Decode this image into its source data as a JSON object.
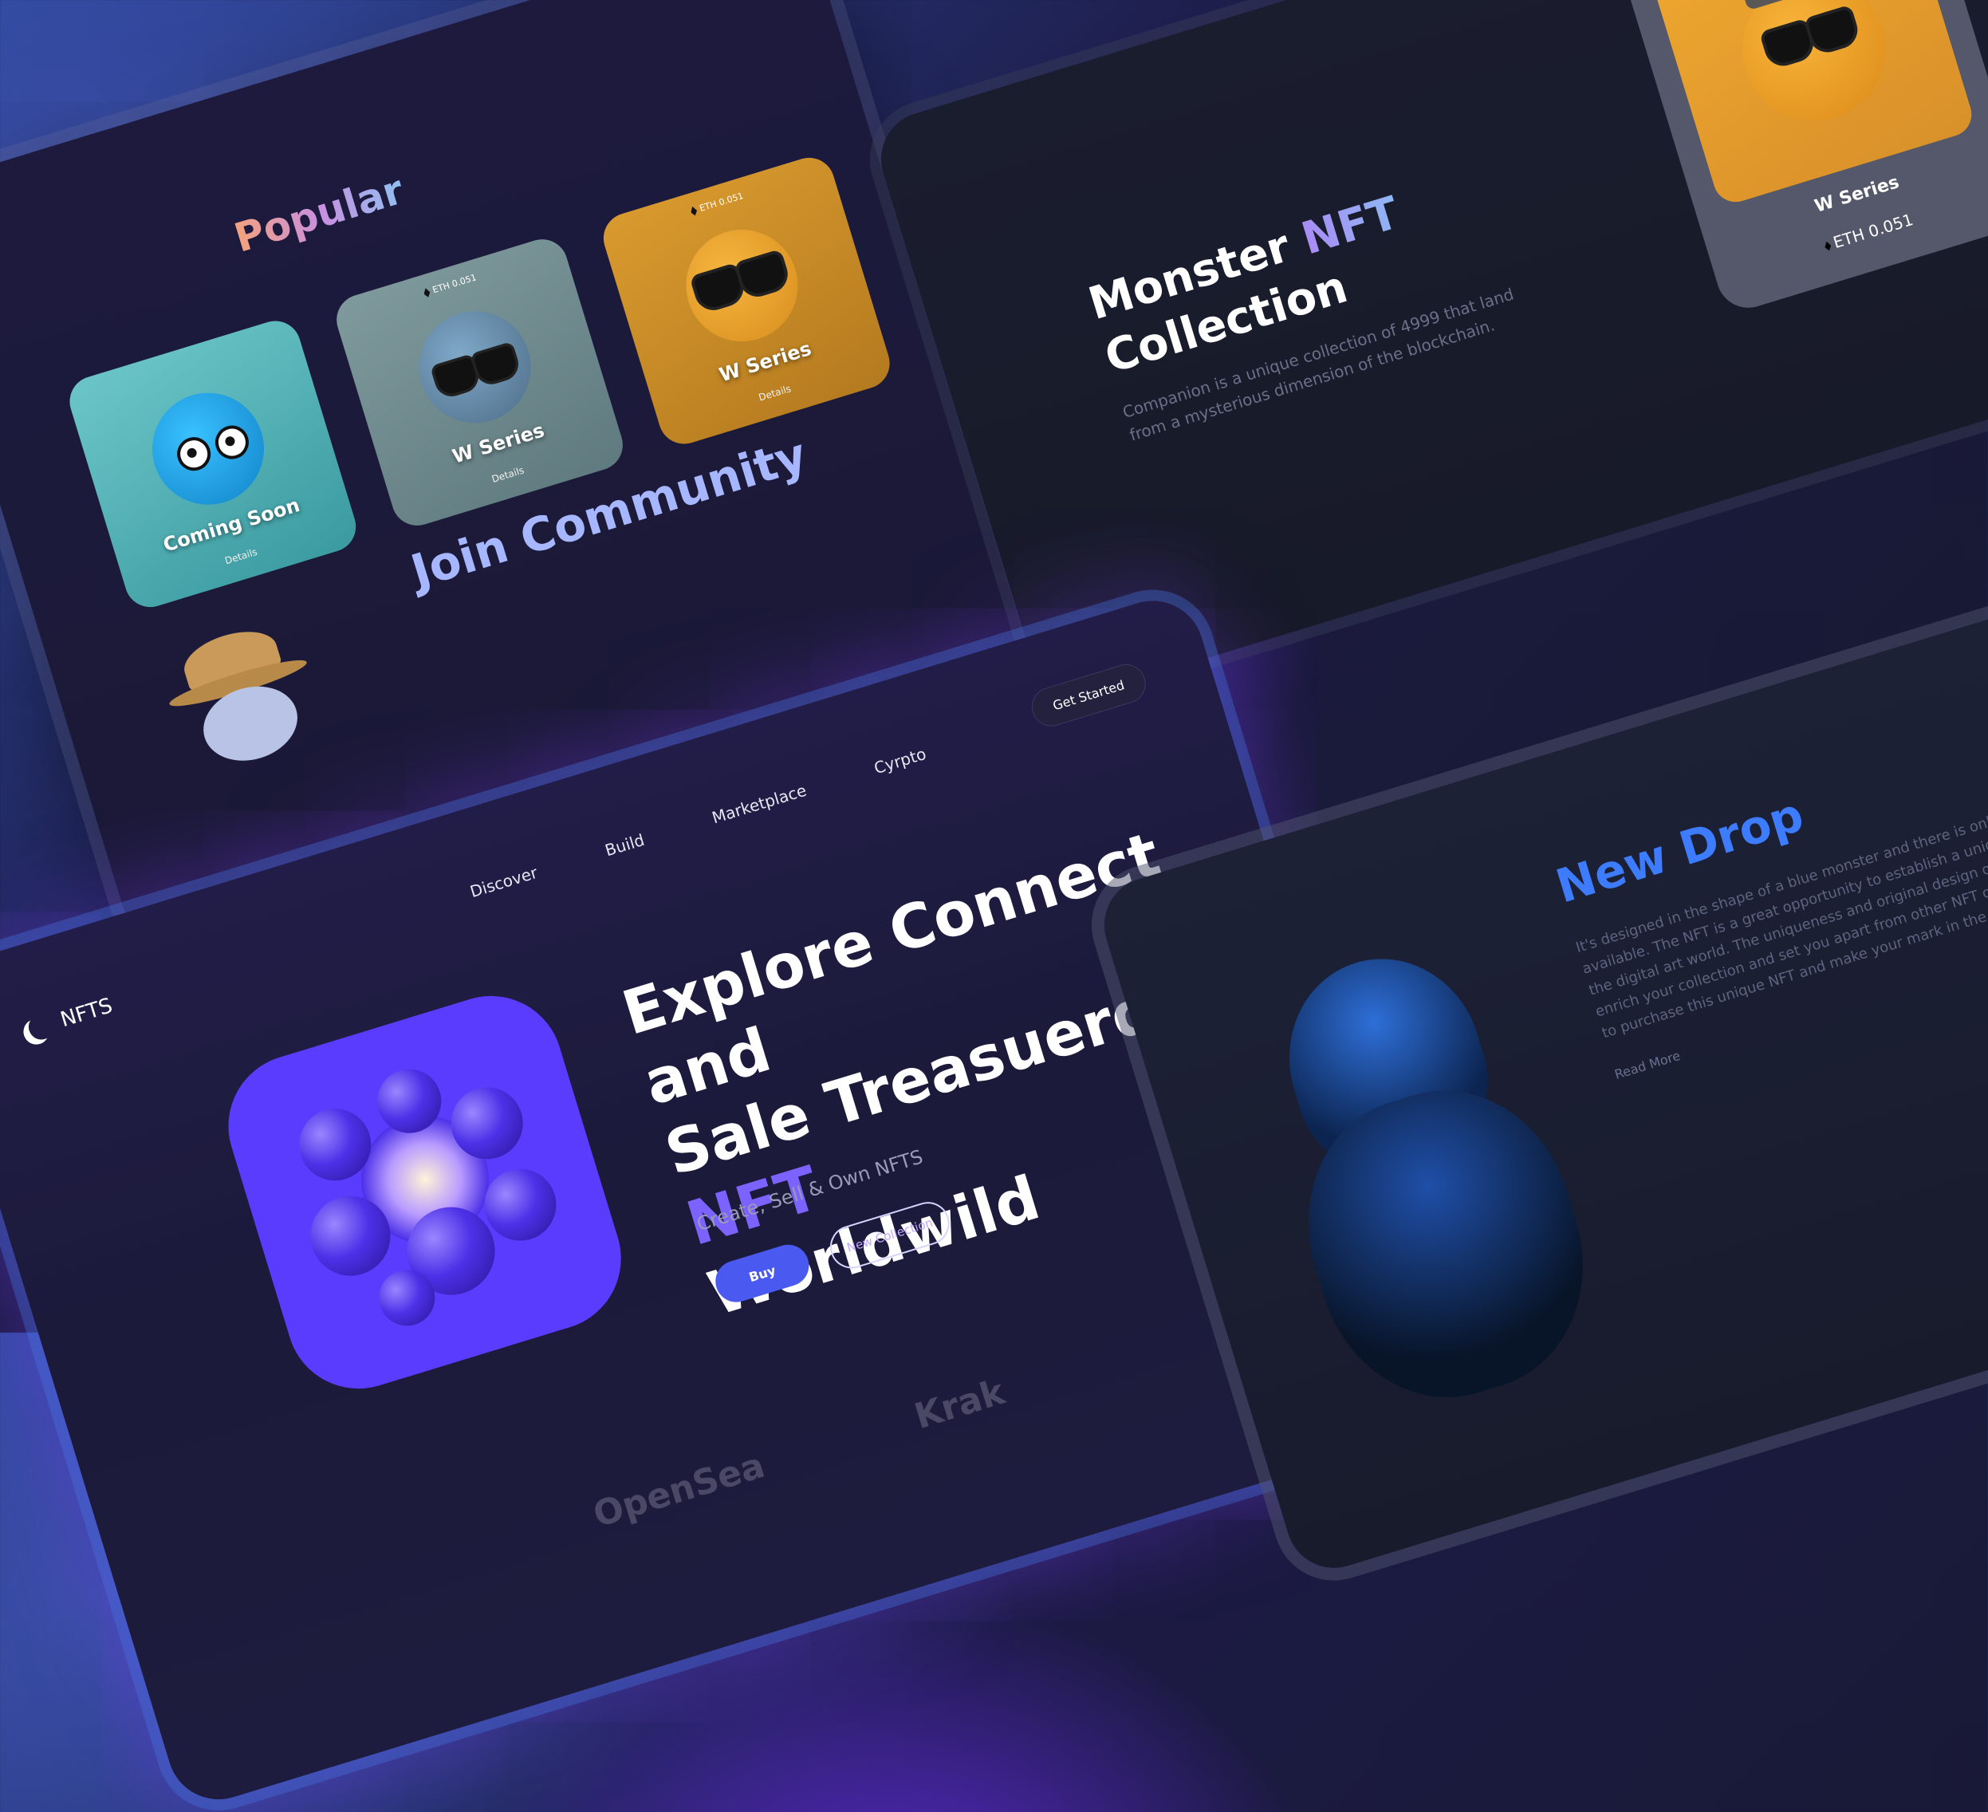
{
  "popular": {
    "title": "Popular",
    "cards": [
      {
        "name": "Coming Soon",
        "details": "Details"
      },
      {
        "name": "W Series",
        "price": "ETH 0.051",
        "details": "Details"
      },
      {
        "name": "W Series",
        "price": "ETH 0.051",
        "details": "Details"
      }
    ],
    "community_title": "Join Community"
  },
  "monster": {
    "title_part1": "Monster ",
    "title_highlight": "NFT",
    "title_part2": "Collection",
    "description": "Companion is a unique collection of 4999 that land from a mysterious dimension of the blockchain.",
    "featured": {
      "name": "W Series",
      "price": "ETH 0.051"
    }
  },
  "hero": {
    "logo_text": "NFTS",
    "nav": [
      "Discover",
      "Build",
      "Marketplace",
      "Cyrpto"
    ],
    "get_started": "Get Started",
    "headline_line1": "Explore Connect and",
    "headline_line2": "Sale Treasuerd ",
    "headline_highlight": "NFT",
    "headline_line3": "Worldwild",
    "subtitle": "Create, Sell & Own NFTS",
    "buy_label": "Buy",
    "collection_label": "New Collection",
    "partners": [
      "OpenSea",
      "Krak"
    ]
  },
  "new_drop": {
    "title": "New Drop",
    "description": "It's designed in the shape of a blue monster and there is only one available. The NFT is a great opportunity to establish a unique place in the digital art world. The uniqueness and original design of the NFT will enrich your collection and set you apart from other NFT owners. Act now to purchase this unique NFT and make your mark in the digital art world.",
    "read_more": "Read More"
  },
  "colors": {
    "accent": "#7c62ff",
    "blue_button": "#4a5af0",
    "new_drop": "#3d7bff"
  }
}
